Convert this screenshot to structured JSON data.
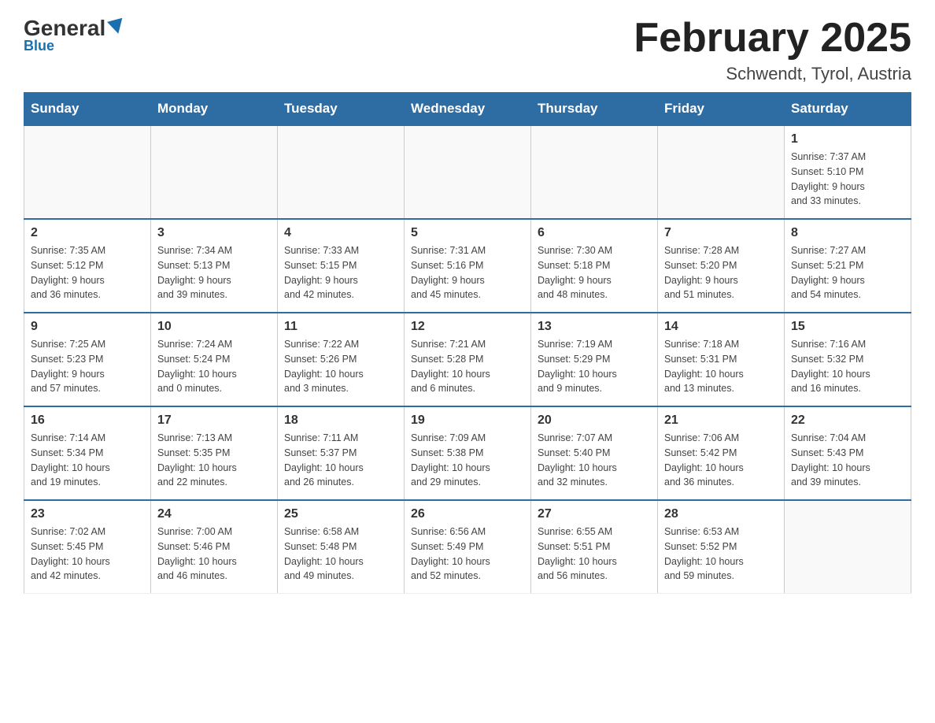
{
  "header": {
    "logo_general": "General",
    "logo_blue": "Blue",
    "month_title": "February 2025",
    "location": "Schwendt, Tyrol, Austria"
  },
  "weekdays": [
    "Sunday",
    "Monday",
    "Tuesday",
    "Wednesday",
    "Thursday",
    "Friday",
    "Saturday"
  ],
  "weeks": [
    [
      {
        "day": "",
        "info": ""
      },
      {
        "day": "",
        "info": ""
      },
      {
        "day": "",
        "info": ""
      },
      {
        "day": "",
        "info": ""
      },
      {
        "day": "",
        "info": ""
      },
      {
        "day": "",
        "info": ""
      },
      {
        "day": "1",
        "info": "Sunrise: 7:37 AM\nSunset: 5:10 PM\nDaylight: 9 hours\nand 33 minutes."
      }
    ],
    [
      {
        "day": "2",
        "info": "Sunrise: 7:35 AM\nSunset: 5:12 PM\nDaylight: 9 hours\nand 36 minutes."
      },
      {
        "day": "3",
        "info": "Sunrise: 7:34 AM\nSunset: 5:13 PM\nDaylight: 9 hours\nand 39 minutes."
      },
      {
        "day": "4",
        "info": "Sunrise: 7:33 AM\nSunset: 5:15 PM\nDaylight: 9 hours\nand 42 minutes."
      },
      {
        "day": "5",
        "info": "Sunrise: 7:31 AM\nSunset: 5:16 PM\nDaylight: 9 hours\nand 45 minutes."
      },
      {
        "day": "6",
        "info": "Sunrise: 7:30 AM\nSunset: 5:18 PM\nDaylight: 9 hours\nand 48 minutes."
      },
      {
        "day": "7",
        "info": "Sunrise: 7:28 AM\nSunset: 5:20 PM\nDaylight: 9 hours\nand 51 minutes."
      },
      {
        "day": "8",
        "info": "Sunrise: 7:27 AM\nSunset: 5:21 PM\nDaylight: 9 hours\nand 54 minutes."
      }
    ],
    [
      {
        "day": "9",
        "info": "Sunrise: 7:25 AM\nSunset: 5:23 PM\nDaylight: 9 hours\nand 57 minutes."
      },
      {
        "day": "10",
        "info": "Sunrise: 7:24 AM\nSunset: 5:24 PM\nDaylight: 10 hours\nand 0 minutes."
      },
      {
        "day": "11",
        "info": "Sunrise: 7:22 AM\nSunset: 5:26 PM\nDaylight: 10 hours\nand 3 minutes."
      },
      {
        "day": "12",
        "info": "Sunrise: 7:21 AM\nSunset: 5:28 PM\nDaylight: 10 hours\nand 6 minutes."
      },
      {
        "day": "13",
        "info": "Sunrise: 7:19 AM\nSunset: 5:29 PM\nDaylight: 10 hours\nand 9 minutes."
      },
      {
        "day": "14",
        "info": "Sunrise: 7:18 AM\nSunset: 5:31 PM\nDaylight: 10 hours\nand 13 minutes."
      },
      {
        "day": "15",
        "info": "Sunrise: 7:16 AM\nSunset: 5:32 PM\nDaylight: 10 hours\nand 16 minutes."
      }
    ],
    [
      {
        "day": "16",
        "info": "Sunrise: 7:14 AM\nSunset: 5:34 PM\nDaylight: 10 hours\nand 19 minutes."
      },
      {
        "day": "17",
        "info": "Sunrise: 7:13 AM\nSunset: 5:35 PM\nDaylight: 10 hours\nand 22 minutes."
      },
      {
        "day": "18",
        "info": "Sunrise: 7:11 AM\nSunset: 5:37 PM\nDaylight: 10 hours\nand 26 minutes."
      },
      {
        "day": "19",
        "info": "Sunrise: 7:09 AM\nSunset: 5:38 PM\nDaylight: 10 hours\nand 29 minutes."
      },
      {
        "day": "20",
        "info": "Sunrise: 7:07 AM\nSunset: 5:40 PM\nDaylight: 10 hours\nand 32 minutes."
      },
      {
        "day": "21",
        "info": "Sunrise: 7:06 AM\nSunset: 5:42 PM\nDaylight: 10 hours\nand 36 minutes."
      },
      {
        "day": "22",
        "info": "Sunrise: 7:04 AM\nSunset: 5:43 PM\nDaylight: 10 hours\nand 39 minutes."
      }
    ],
    [
      {
        "day": "23",
        "info": "Sunrise: 7:02 AM\nSunset: 5:45 PM\nDaylight: 10 hours\nand 42 minutes."
      },
      {
        "day": "24",
        "info": "Sunrise: 7:00 AM\nSunset: 5:46 PM\nDaylight: 10 hours\nand 46 minutes."
      },
      {
        "day": "25",
        "info": "Sunrise: 6:58 AM\nSunset: 5:48 PM\nDaylight: 10 hours\nand 49 minutes."
      },
      {
        "day": "26",
        "info": "Sunrise: 6:56 AM\nSunset: 5:49 PM\nDaylight: 10 hours\nand 52 minutes."
      },
      {
        "day": "27",
        "info": "Sunrise: 6:55 AM\nSunset: 5:51 PM\nDaylight: 10 hours\nand 56 minutes."
      },
      {
        "day": "28",
        "info": "Sunrise: 6:53 AM\nSunset: 5:52 PM\nDaylight: 10 hours\nand 59 minutes."
      },
      {
        "day": "",
        "info": ""
      }
    ]
  ]
}
